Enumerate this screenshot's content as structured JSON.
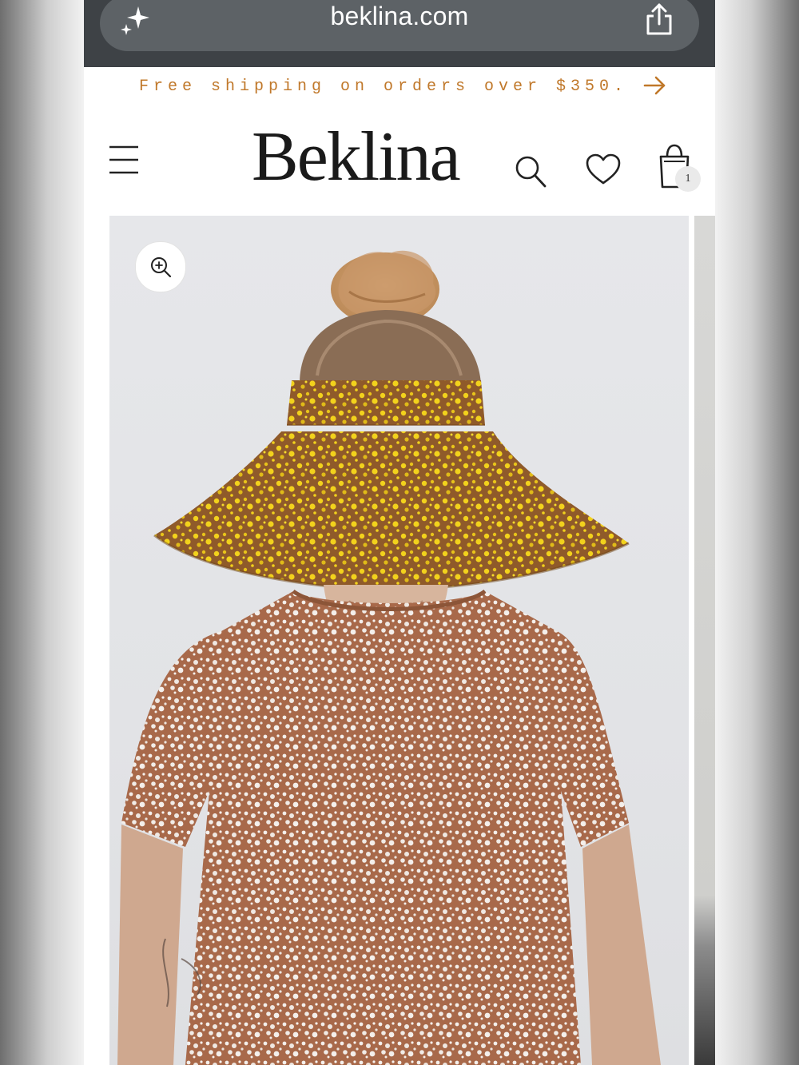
{
  "browser": {
    "url": "beklina.com"
  },
  "promo": {
    "text": "Free shipping on orders over $350."
  },
  "header": {
    "logo": "Beklina",
    "cart_count": "1"
  },
  "icons": {
    "ai": "sparkle-icon",
    "share": "share-icon",
    "promo_arrow": "arrow-right-icon",
    "menu": "hamburger-menu-icon",
    "search": "search-icon",
    "wishlist": "heart-icon",
    "cart": "shopping-bag-icon",
    "zoom": "zoom-in-icon"
  },
  "colors": {
    "promo_text": "#c0782a",
    "browser_bar": "#3e4246",
    "url_pill": "#5d6266",
    "hat_yellow": "#e5c21d",
    "shirt_brown": "#a66a48"
  }
}
